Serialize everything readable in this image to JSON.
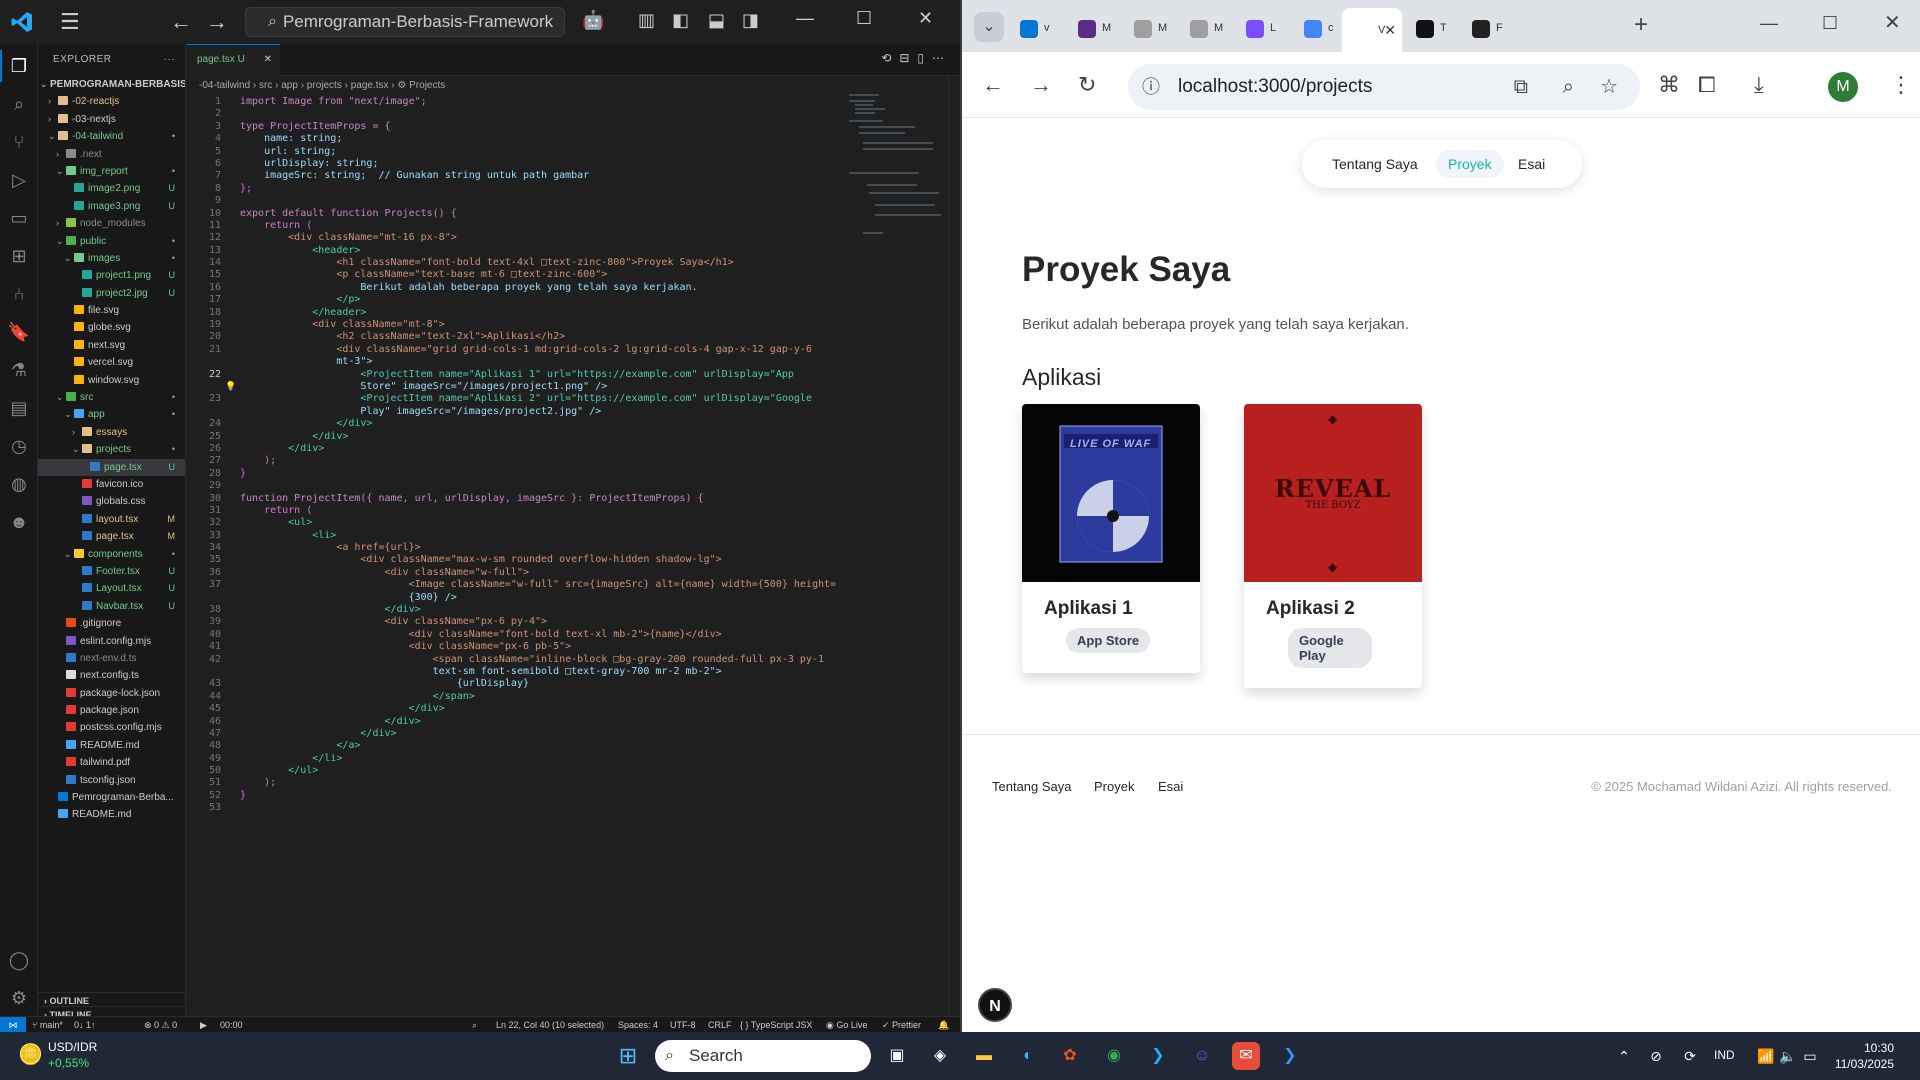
{
  "vscode": {
    "search": "Pemrograman-Berbasis-Framework",
    "explorer_title": "EXPLORER",
    "root": "PEMROGRAMAN-BERBASIS-F...",
    "tree": [
      {
        "label": "-02-reactjs",
        "depth": 1,
        "chev": "›",
        "color": "#e2c08d",
        "st": "",
        "cls": "m"
      },
      {
        "label": "-03-nextjs",
        "depth": 1,
        "chev": "›",
        "color": "#e2c08d",
        "st": "",
        "cls": ""
      },
      {
        "label": "-04-tailwind",
        "depth": 1,
        "chev": "⌄",
        "color": "#e2c08d",
        "st": "•",
        "cls": "g"
      },
      {
        "label": ".next",
        "depth": 2,
        "chev": "›",
        "color": "#8b8b8b",
        "st": "",
        "cls": "grey"
      },
      {
        "label": "img_report",
        "depth": 2,
        "chev": "⌄",
        "color": "#73c991",
        "st": "•",
        "cls": "g"
      },
      {
        "label": "image2.png",
        "depth": 3,
        "chev": "",
        "color": "#26a69a",
        "st": "U",
        "cls": "g"
      },
      {
        "label": "image3.png",
        "depth": 3,
        "chev": "",
        "color": "#26a69a",
        "st": "U",
        "cls": "g"
      },
      {
        "label": "node_modules",
        "depth": 2,
        "chev": "›",
        "color": "#8bc34a",
        "st": "",
        "cls": "grey"
      },
      {
        "label": "public",
        "depth": 2,
        "chev": "⌄",
        "color": "#4caf50",
        "st": "•",
        "cls": "g"
      },
      {
        "label": "images",
        "depth": 3,
        "chev": "⌄",
        "color": "#73c991",
        "st": "•",
        "cls": "g"
      },
      {
        "label": "project1.png",
        "depth": 4,
        "chev": "",
        "color": "#26a69a",
        "st": "U",
        "cls": "g"
      },
      {
        "label": "project2.jpg",
        "depth": 4,
        "chev": "",
        "color": "#26a69a",
        "st": "U",
        "cls": "g"
      },
      {
        "label": "file.svg",
        "depth": 3,
        "chev": "",
        "color": "#ffb300",
        "st": "",
        "cls": ""
      },
      {
        "label": "globe.svg",
        "depth": 3,
        "chev": "",
        "color": "#ffb300",
        "st": "",
        "cls": ""
      },
      {
        "label": "next.svg",
        "depth": 3,
        "chev": "",
        "color": "#ffb300",
        "st": "",
        "cls": ""
      },
      {
        "label": "vercel.svg",
        "depth": 3,
        "chev": "",
        "color": "#ffb300",
        "st": "",
        "cls": ""
      },
      {
        "label": "window.svg",
        "depth": 3,
        "chev": "",
        "color": "#ffb300",
        "st": "",
        "cls": ""
      },
      {
        "label": "src",
        "depth": 2,
        "chev": "⌄",
        "color": "#4caf50",
        "st": "•",
        "cls": "g"
      },
      {
        "label": "app",
        "depth": 3,
        "chev": "⌄",
        "color": "#42a5f5",
        "st": "•",
        "cls": "g"
      },
      {
        "label": "essays",
        "depth": 4,
        "chev": "›",
        "color": "#e2c08d",
        "st": "",
        "cls": "m"
      },
      {
        "label": "projects",
        "depth": 4,
        "chev": "⌄",
        "color": "#e2c08d",
        "st": "•",
        "cls": "g"
      },
      {
        "label": "page.tsx",
        "depth": 5,
        "chev": "",
        "color": "#3178c6",
        "st": "U",
        "cls": "g",
        "sel": true
      },
      {
        "label": "favicon.ico",
        "depth": 4,
        "chev": "",
        "color": "#e53935",
        "st": "",
        "cls": ""
      },
      {
        "label": "globals.css",
        "depth": 4,
        "chev": "",
        "color": "#7e57c2",
        "st": "",
        "cls": ""
      },
      {
        "label": "layout.tsx",
        "depth": 4,
        "chev": "",
        "color": "#3178c6",
        "st": "M",
        "cls": "m"
      },
      {
        "label": "page.tsx",
        "depth": 4,
        "chev": "",
        "color": "#3178c6",
        "st": "M",
        "cls": "m"
      },
      {
        "label": "components",
        "depth": 3,
        "chev": "⌄",
        "color": "#ffca28",
        "st": "•",
        "cls": "g"
      },
      {
        "label": "Footer.tsx",
        "depth": 4,
        "chev": "",
        "color": "#3178c6",
        "st": "U",
        "cls": "g"
      },
      {
        "label": "Layout.tsx",
        "depth": 4,
        "chev": "",
        "color": "#3178c6",
        "st": "U",
        "cls": "g"
      },
      {
        "label": "Navbar.tsx",
        "depth": 4,
        "chev": "",
        "color": "#3178c6",
        "st": "U",
        "cls": "g"
      },
      {
        "label": ".gitignore",
        "depth": 2,
        "chev": "",
        "color": "#e64a19",
        "st": "",
        "cls": ""
      },
      {
        "label": "eslint.config.mjs",
        "depth": 2,
        "chev": "",
        "color": "#7e57c2",
        "st": "",
        "cls": ""
      },
      {
        "label": "next-env.d.ts",
        "depth": 2,
        "chev": "",
        "color": "#3178c6",
        "st": "",
        "cls": "grey"
      },
      {
        "label": "next.config.ts",
        "depth": 2,
        "chev": "",
        "color": "#ddd",
        "st": "",
        "cls": ""
      },
      {
        "label": "package-lock.json",
        "depth": 2,
        "chev": "",
        "color": "#e53935",
        "st": "",
        "cls": ""
      },
      {
        "label": "package.json",
        "depth": 2,
        "chev": "",
        "color": "#e53935",
        "st": "",
        "cls": ""
      },
      {
        "label": "postcss.config.mjs",
        "depth": 2,
        "chev": "",
        "color": "#e53935",
        "st": "",
        "cls": ""
      },
      {
        "label": "README.md",
        "depth": 2,
        "chev": "",
        "color": "#42a5f5",
        "st": "",
        "cls": ""
      },
      {
        "label": "tailwind.pdf",
        "depth": 2,
        "chev": "",
        "color": "#e53935",
        "st": "",
        "cls": ""
      },
      {
        "label": "tsconfig.json",
        "depth": 2,
        "chev": "",
        "color": "#3178c6",
        "st": "",
        "cls": ""
      },
      {
        "label": "Pemrograman-Berba...",
        "depth": 1,
        "chev": "",
        "color": "#0078d4",
        "st": "",
        "cls": ""
      },
      {
        "label": "README.md",
        "depth": 1,
        "chev": "",
        "color": "#42a5f5",
        "st": "",
        "cls": ""
      }
    ],
    "outline": "OUTLINE",
    "timeline": "TIMELINE",
    "tab": "page.tsx U",
    "breadcrumb": "-04-tailwind › src › app › projects › page.tsx › ⚙ Projects",
    "code": [
      {
        "n": "1",
        "t": "import Image from \"next/image\";"
      },
      {
        "n": "2",
        "t": ""
      },
      {
        "n": "3",
        "t": "type ProjectItemProps = {"
      },
      {
        "n": "4",
        "t": "    name: string;"
      },
      {
        "n": "5",
        "t": "    url: string;"
      },
      {
        "n": "6",
        "t": "    urlDisplay: string;"
      },
      {
        "n": "7",
        "t": "    imageSrc: string;  // Gunakan string untuk path gambar"
      },
      {
        "n": "8",
        "t": "};"
      },
      {
        "n": "9",
        "t": ""
      },
      {
        "n": "10",
        "t": "export default function Projects() {"
      },
      {
        "n": "11",
        "t": "    return ("
      },
      {
        "n": "12",
        "t": "        <div className=\"mt-16 px-8\">"
      },
      {
        "n": "13",
        "t": "            <header>"
      },
      {
        "n": "14",
        "t": "                <h1 className=\"font-bold text-4xl □text-zinc-800\">Proyek Saya</h1>"
      },
      {
        "n": "15",
        "t": "                <p className=\"text-base mt-6 □text-zinc-600\">"
      },
      {
        "n": "16",
        "t": "                    Berikut adalah beberapa proyek yang telah saya kerjakan."
      },
      {
        "n": "17",
        "t": "                </p>"
      },
      {
        "n": "18",
        "t": "            </header>"
      },
      {
        "n": "19",
        "t": "            <div className=\"mt-8\">"
      },
      {
        "n": "20",
        "t": "                <h2 className=\"text-2xl\">Aplikasi</h2>"
      },
      {
        "n": "21",
        "t": "                <div className=\"grid grid-cols-1 md:grid-cols-2 lg:grid-cols-4 gap-x-12 gap-y-6"
      },
      {
        "n": "",
        "t": "                mt-3\">"
      },
      {
        "n": "22",
        "t": "                    <ProjectItem name=\"Aplikasi 1\" url=\"https://example.com\" urlDisplay=\"App"
      },
      {
        "n": "",
        "t": "                    Store\" imageSrc=\"/images/project1.png\" />"
      },
      {
        "n": "23",
        "t": "                    <ProjectItem name=\"Aplikasi 2\" url=\"https://example.com\" urlDisplay=\"Google"
      },
      {
        "n": "",
        "t": "                    Play\" imageSrc=\"/images/project2.jpg\" />"
      },
      {
        "n": "24",
        "t": "                </div>"
      },
      {
        "n": "25",
        "t": "            </div>"
      },
      {
        "n": "26",
        "t": "        </div>"
      },
      {
        "n": "27",
        "t": "    );"
      },
      {
        "n": "28",
        "t": "}"
      },
      {
        "n": "29",
        "t": ""
      },
      {
        "n": "30",
        "t": "function ProjectItem({ name, url, urlDisplay, imageSrc }: ProjectItemProps) {"
      },
      {
        "n": "31",
        "t": "    return ("
      },
      {
        "n": "32",
        "t": "        <ul>"
      },
      {
        "n": "33",
        "t": "            <li>"
      },
      {
        "n": "34",
        "t": "                <a href={url}>"
      },
      {
        "n": "35",
        "t": "                    <div className=\"max-w-sm rounded overflow-hidden shadow-lg\">"
      },
      {
        "n": "36",
        "t": "                        <div className=\"w-full\">"
      },
      {
        "n": "37",
        "t": "                            <Image className=\"w-full\" src={imageSrc} alt={name} width={500} height="
      },
      {
        "n": "",
        "t": "                            {300} />"
      },
      {
        "n": "38",
        "t": "                        </div>"
      },
      {
        "n": "39",
        "t": "                        <div className=\"px-6 py-4\">"
      },
      {
        "n": "40",
        "t": "                            <div className=\"font-bold text-xl mb-2\">{name}</div>"
      },
      {
        "n": "41",
        "t": "                            <div className=\"px-6 pb-5\">"
      },
      {
        "n": "42",
        "t": "                                <span className=\"inline-block □bg-gray-200 rounded-full px-3 py-1"
      },
      {
        "n": "",
        "t": "                                text-sm font-semibold □text-gray-700 mr-2 mb-2\">"
      },
      {
        "n": "43",
        "t": "                                    {urlDisplay}"
      },
      {
        "n": "44",
        "t": "                                </span>"
      },
      {
        "n": "45",
        "t": "                            </div>"
      },
      {
        "n": "46",
        "t": "                        </div>"
      },
      {
        "n": "47",
        "t": "                    </div>"
      },
      {
        "n": "48",
        "t": "                </a>"
      },
      {
        "n": "49",
        "t": "            </li>"
      },
      {
        "n": "50",
        "t": "        </ul>"
      },
      {
        "n": "51",
        "t": "    );"
      },
      {
        "n": "52",
        "t": "}"
      },
      {
        "n": "53",
        "t": ""
      }
    ],
    "status": {
      "branch": "main*",
      "sync": "0↓ 1↑",
      "problems": "⊗ 0 ⚠ 0",
      "time": "00:00",
      "position": "Ln 22, Col 40 (10 selected)",
      "spaces": "Spaces: 4",
      "encoding": "UTF-8",
      "eol": "CRLF",
      "language": "{ } TypeScript JSX",
      "golive": "Go Live",
      "prettier": "✓ Prettier"
    }
  },
  "browser": {
    "tabs": [
      {
        "letter": "v",
        "color": "#0078d4"
      },
      {
        "letter": "M",
        "color": "#5b2c83"
      },
      {
        "letter": "M",
        "color": "#9e9e9e"
      },
      {
        "letter": "M",
        "color": "#9e9e9e"
      },
      {
        "letter": "L",
        "color": "#7c4dff"
      },
      {
        "letter": "c",
        "color": "#4285f4"
      },
      {
        "letter": "V",
        "color": "#ffffff"
      },
      {
        "letter": "T",
        "color": "#111111"
      },
      {
        "letter": "F",
        "color": "#222222"
      }
    ],
    "url": "localhost:3000/projects",
    "avatar": "M"
  },
  "site": {
    "nav": [
      "Tentang Saya",
      "Proyek",
      "Esai"
    ],
    "title": "Proyek Saya",
    "lead": "Berikut adalah beberapa proyek yang telah saya kerjakan.",
    "section": "Aplikasi",
    "projects": [
      {
        "name": "Aplikasi 1",
        "badge": "App Store"
      },
      {
        "name": "Aplikasi 2",
        "badge": "Google Play"
      }
    ],
    "album1_text": "LIVE OF WAF",
    "album2_title": "REVEAL",
    "album2_sub": "THE BOYZ",
    "footer_links": [
      "Tentang Saya",
      "Proyek",
      "Esai"
    ],
    "copyright": "© 2025 Mochamad Wildani Azizi. All rights reserved.",
    "next_badge": "N"
  },
  "taskbar": {
    "stock": "USD/IDR",
    "change": "+0,55%",
    "search": "Search",
    "lang": "IND",
    "time": "10:30",
    "date": "11/03/2025"
  }
}
